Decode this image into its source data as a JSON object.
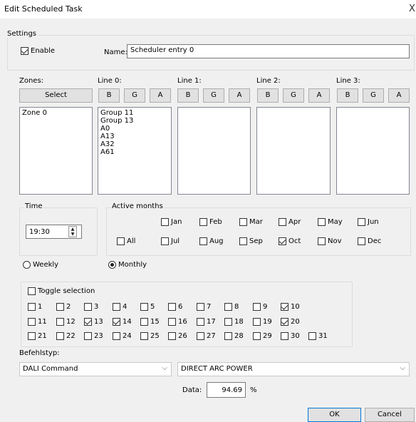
{
  "window": {
    "title": "Edit Scheduled Task",
    "close": "X"
  },
  "settings": {
    "legend": "Settings",
    "enable": {
      "label": "Enable",
      "checked": true
    },
    "name_label": "Name:",
    "name_value": "Scheduler entry 0"
  },
  "zones": {
    "label": "Zones:",
    "select_button": "Select",
    "items": [
      "Zone 0"
    ]
  },
  "lines": [
    {
      "label": "Line 0:",
      "buttons": [
        "B",
        "G",
        "A"
      ],
      "items": [
        "Group 11",
        "Group 13",
        "A0",
        "A13",
        "A32",
        "A61"
      ]
    },
    {
      "label": "Line 1:",
      "buttons": [
        "B",
        "G",
        "A"
      ],
      "items": []
    },
    {
      "label": "Line 2:",
      "buttons": [
        "B",
        "G",
        "A"
      ],
      "items": []
    },
    {
      "label": "Line 3:",
      "buttons": [
        "B",
        "G",
        "A"
      ],
      "items": []
    }
  ],
  "time": {
    "legend": "Time",
    "value": "19:30"
  },
  "months": {
    "legend": "Active months",
    "all": {
      "label": "All",
      "checked": false
    },
    "row1": [
      {
        "label": "Jan",
        "checked": false
      },
      {
        "label": "Feb",
        "checked": false
      },
      {
        "label": "Mar",
        "checked": false
      },
      {
        "label": "Apr",
        "checked": false
      },
      {
        "label": "May",
        "checked": false
      },
      {
        "label": "Jun",
        "checked": false
      }
    ],
    "row2": [
      {
        "label": "Jul",
        "checked": false
      },
      {
        "label": "Aug",
        "checked": false
      },
      {
        "label": "Sep",
        "checked": false
      },
      {
        "label": "Oct",
        "checked": true
      },
      {
        "label": "Nov",
        "checked": false
      },
      {
        "label": "Dec",
        "checked": false
      }
    ]
  },
  "mode": {
    "weekly": "Weekly",
    "monthly": "Monthly",
    "selected": "monthly"
  },
  "days": {
    "toggle_label": "Toggle selection",
    "row1": [
      {
        "l": "1",
        "c": false
      },
      {
        "l": "2",
        "c": false
      },
      {
        "l": "3",
        "c": false
      },
      {
        "l": "4",
        "c": false
      },
      {
        "l": "5",
        "c": false
      },
      {
        "l": "6",
        "c": false
      },
      {
        "l": "7",
        "c": false
      },
      {
        "l": "8",
        "c": false
      },
      {
        "l": "9",
        "c": false
      },
      {
        "l": "10",
        "c": true
      }
    ],
    "row2": [
      {
        "l": "11",
        "c": false
      },
      {
        "l": "12",
        "c": false
      },
      {
        "l": "13",
        "c": true
      },
      {
        "l": "14",
        "c": true
      },
      {
        "l": "15",
        "c": false
      },
      {
        "l": "16",
        "c": false
      },
      {
        "l": "17",
        "c": false
      },
      {
        "l": "18",
        "c": false
      },
      {
        "l": "19",
        "c": false
      },
      {
        "l": "20",
        "c": true
      }
    ],
    "row3": [
      {
        "l": "21",
        "c": false
      },
      {
        "l": "22",
        "c": false
      },
      {
        "l": "23",
        "c": false
      },
      {
        "l": "24",
        "c": false
      },
      {
        "l": "25",
        "c": false
      },
      {
        "l": "26",
        "c": false
      },
      {
        "l": "27",
        "c": false
      },
      {
        "l": "28",
        "c": false
      },
      {
        "l": "29",
        "c": false
      },
      {
        "l": "30",
        "c": false
      },
      {
        "l": "31",
        "c": false
      }
    ]
  },
  "command": {
    "label": "Befehlstyp:",
    "type_value": "DALI Command",
    "command_value": "DIRECT ARC POWER",
    "data_label": "Data:",
    "data_value": "94.69",
    "unit": "%"
  },
  "footer": {
    "ok": "OK",
    "cancel": "Cancel"
  }
}
